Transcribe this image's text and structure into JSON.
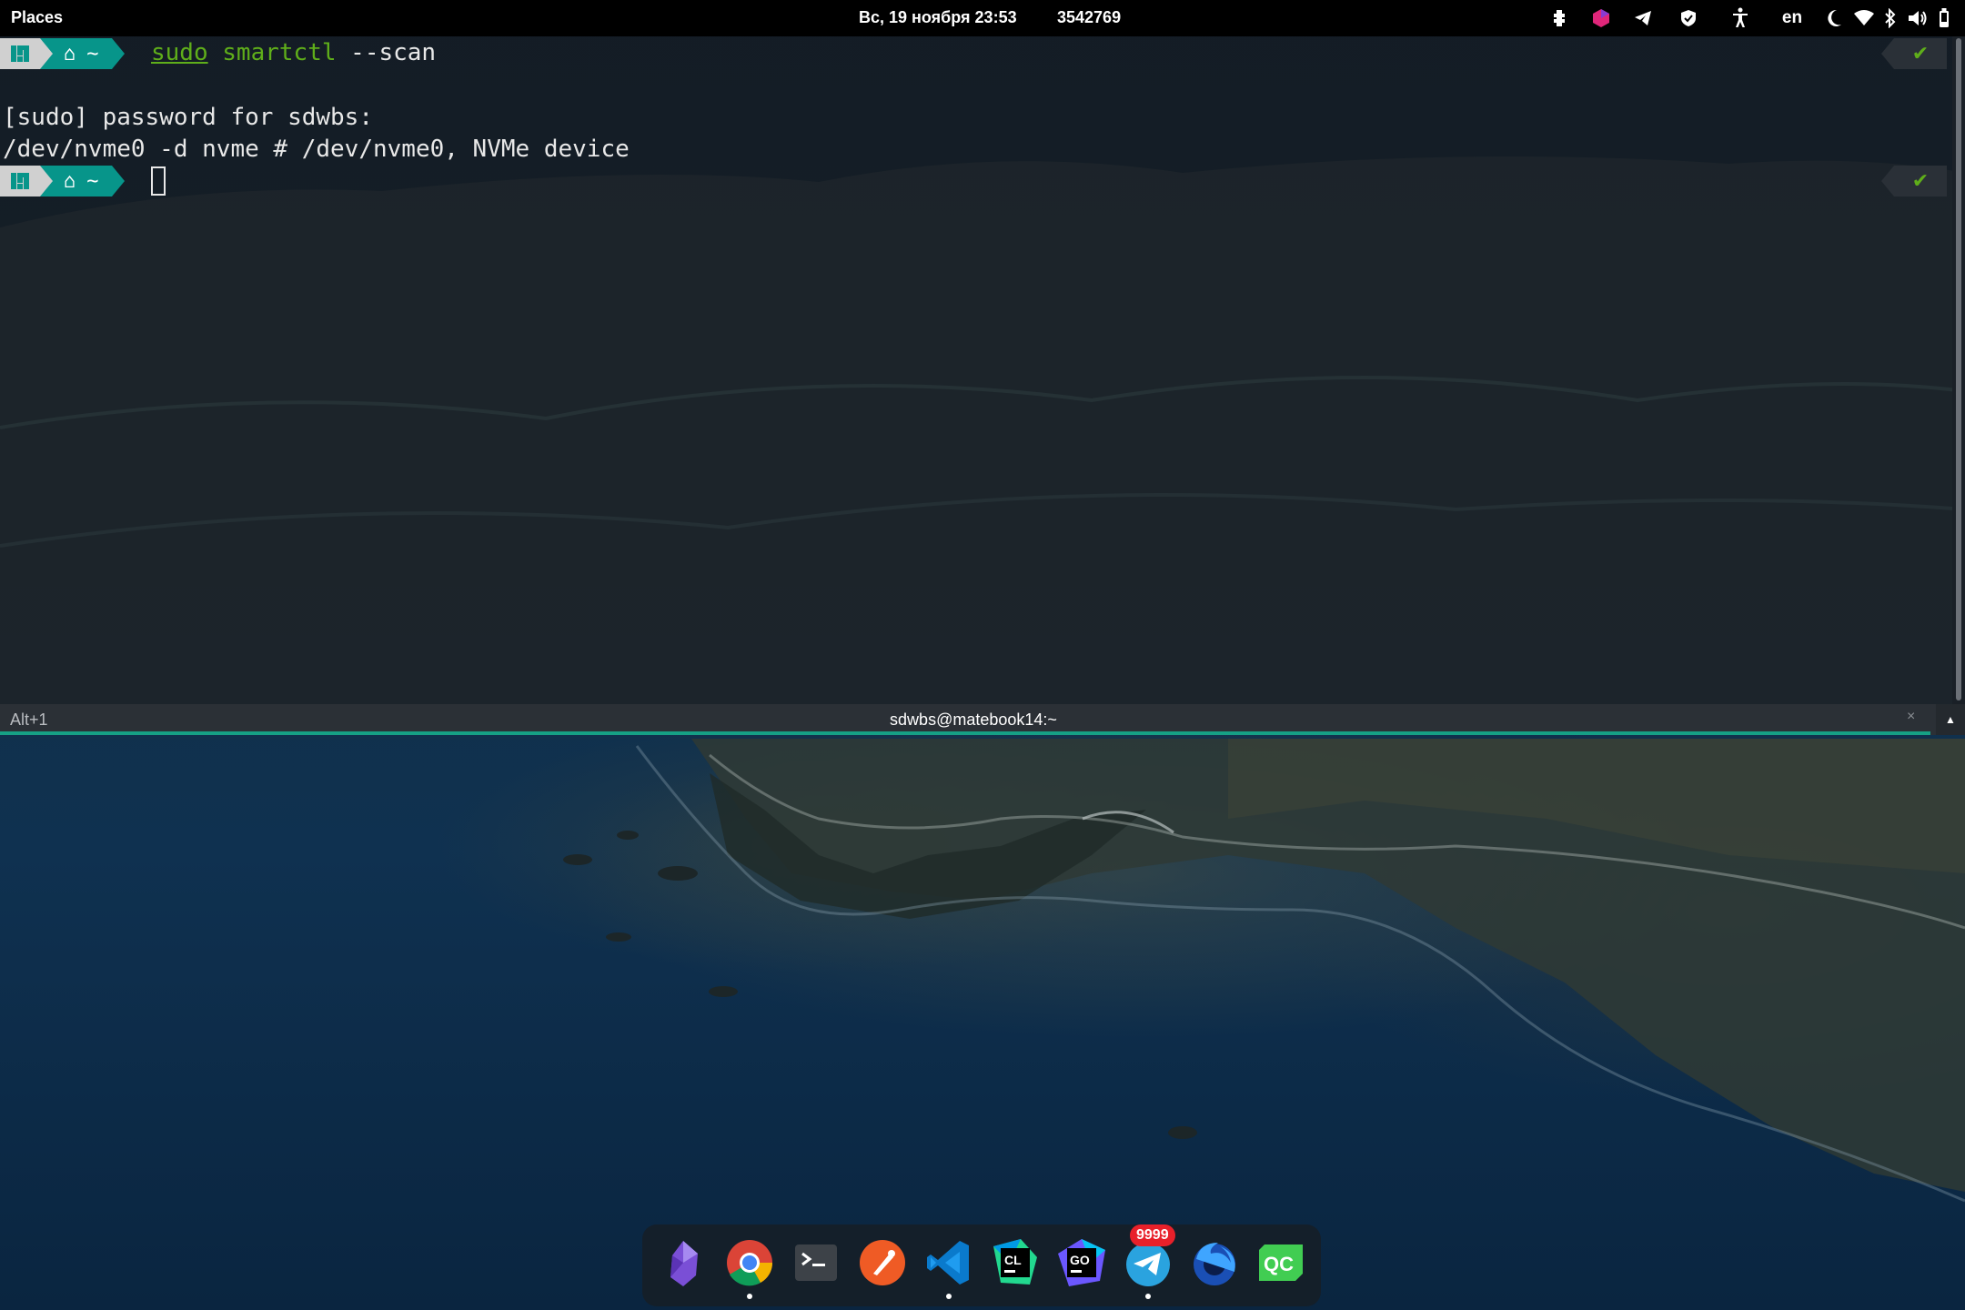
{
  "topbar": {
    "places_label": "Places",
    "clock": "Вс, 19 ноября  23:53",
    "counter": "3542769",
    "language": "en",
    "tray_icons": [
      "extension-icon",
      "app-indicator-icon",
      "telegram-tray-icon",
      "shield-icon",
      "accessibility-icon",
      "night-light-icon",
      "wifi-icon",
      "bluetooth-icon",
      "volume-icon",
      "battery-icon"
    ]
  },
  "terminal": {
    "prompt_home_glyph": "⌂",
    "prompt_dir": "~",
    "command": {
      "sudo": "sudo",
      "program": "smartctl",
      "args": " --scan"
    },
    "output_lines": [
      "[sudo] password for sdwbs:",
      "/dev/nvme0 -d nvme # /dev/nvme0, NVMe device"
    ],
    "status_check": "✔"
  },
  "tabbar": {
    "shortcut": "Alt+1",
    "title": "sdwbs@matebook14:~",
    "close": "×",
    "toggle": "▲"
  },
  "dock": {
    "items": [
      {
        "name": "obsidian",
        "running": false
      },
      {
        "name": "chrome",
        "running": true
      },
      {
        "name": "terminal",
        "running": false
      },
      {
        "name": "postman",
        "running": false
      },
      {
        "name": "vscode",
        "running": true
      },
      {
        "name": "clion",
        "running": false
      },
      {
        "name": "goland",
        "running": false
      },
      {
        "name": "telegram",
        "running": true,
        "badge": "9999"
      },
      {
        "name": "firefox-developer",
        "running": false
      },
      {
        "name": "qt-creator",
        "running": false
      }
    ],
    "clion_label": "CL",
    "goland_label": "GO",
    "qt_label": "QC"
  },
  "colors": {
    "accent_teal": "#07958a",
    "command_green": "#5fae1a",
    "badge_red": "#e8202a"
  }
}
